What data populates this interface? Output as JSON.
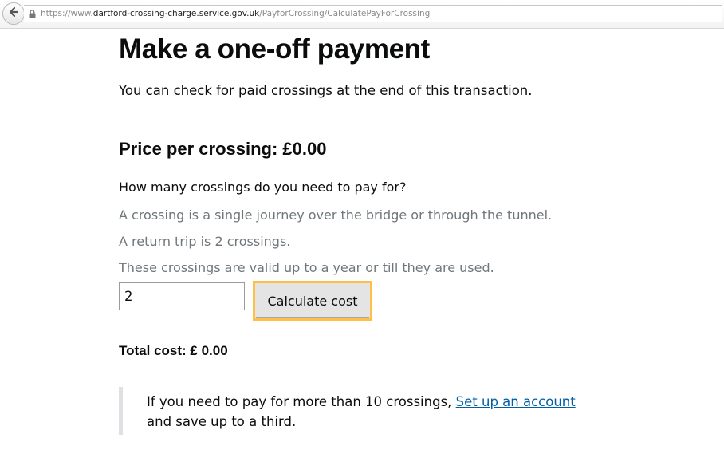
{
  "browser": {
    "url_prefix": "https://www.",
    "url_domain": "dartford-crossing-charge.service.gov.uk",
    "url_path": "/PayforCrossing/CalculatePayForCrossing"
  },
  "page": {
    "title": "Make a one-off payment",
    "lead": "You can check for paid crossings at the end of this transaction.",
    "price_heading": "Price per crossing: £0.00",
    "question": "How many crossings do you need to pay for?",
    "hints": [
      "A crossing is a single journey over the bridge or through the tunnel.",
      "A return trip is 2 crossings.",
      "These crossings are valid up to a year or till they are used."
    ],
    "crossings_input_value": "2",
    "calculate_button_label": "Calculate cost",
    "total_cost": "Total cost: £ 0.00",
    "inset": {
      "text_before": "If you need to pay for more than 10 crossings, ",
      "link_text": "Set up an account",
      "text_after": " and save up to a third."
    }
  },
  "icons": {
    "back": "back-arrow-icon",
    "lock": "lock-icon"
  },
  "colors": {
    "link": "#005ea5",
    "focus": "#ffbf47",
    "hint": "#6f777b"
  }
}
